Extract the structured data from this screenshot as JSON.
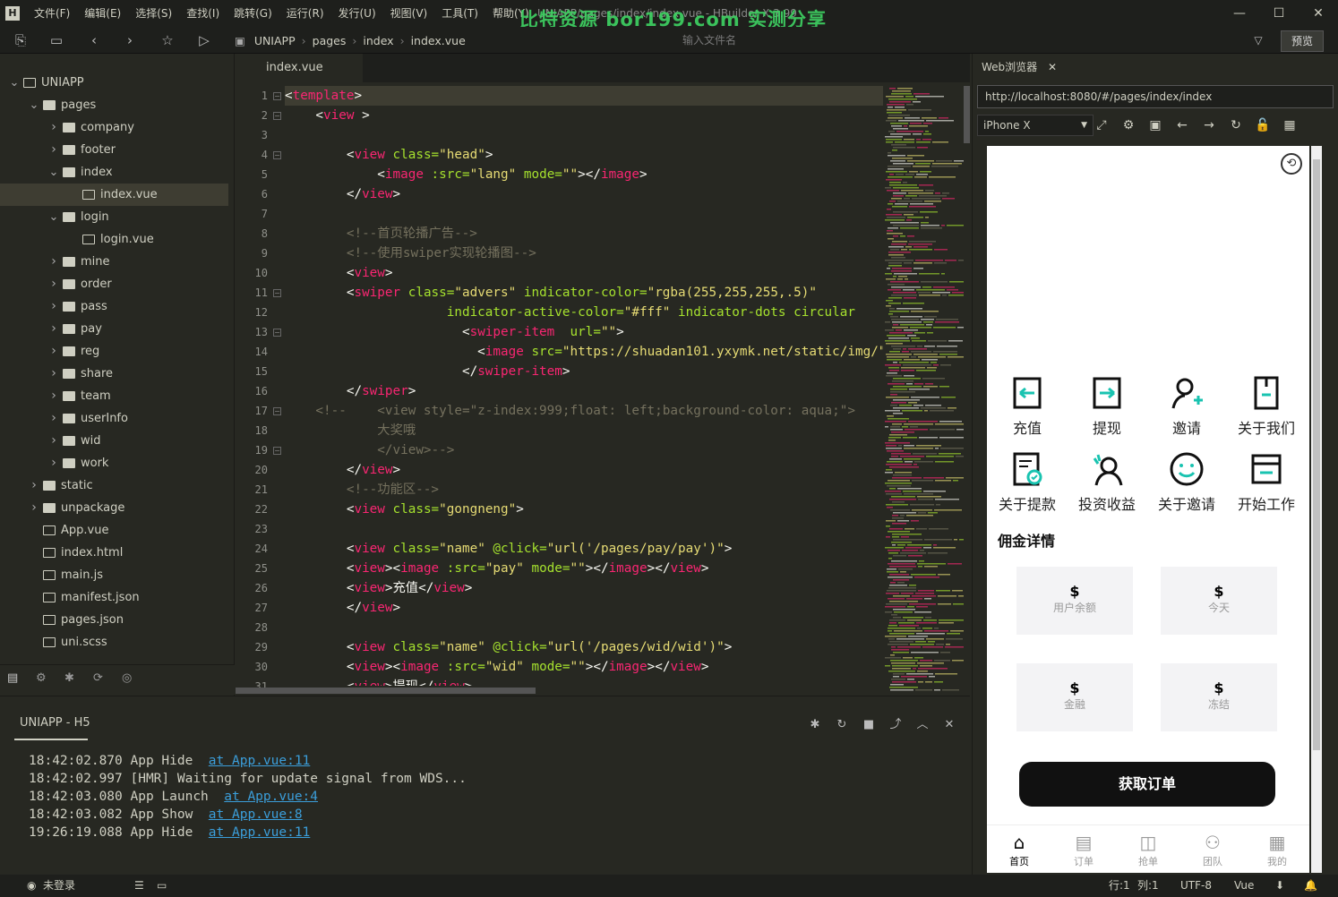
{
  "app": {
    "window_title": "UNIAPP/pages/index/index.vue - HBuilder X 3.99",
    "watermark": "比特资源 bor199.com 实测分享"
  },
  "menu": [
    "文件(F)",
    "编辑(E)",
    "选择(S)",
    "查找(I)",
    "跳转(G)",
    "运行(R)",
    "发行(U)",
    "视图(V)",
    "工具(T)",
    "帮助(Y)"
  ],
  "breadcrumb": [
    "UNIAPP",
    "pages",
    "index",
    "index.vue"
  ],
  "toolbar": {
    "file_search_placeholder": "输入文件名",
    "preview_label": "预览"
  },
  "sidebar": {
    "project": "UNIAPP",
    "items": [
      {
        "label": "pages",
        "type": "folder",
        "depth": 1,
        "open": true
      },
      {
        "label": "company",
        "type": "folder",
        "depth": 2,
        "open": false
      },
      {
        "label": "footer",
        "type": "folder",
        "depth": 2,
        "open": false
      },
      {
        "label": "index",
        "type": "folder",
        "depth": 2,
        "open": true
      },
      {
        "label": "index.vue",
        "type": "vue",
        "depth": 3,
        "selected": true
      },
      {
        "label": "login",
        "type": "folder",
        "depth": 2,
        "open": true
      },
      {
        "label": "login.vue",
        "type": "vue",
        "depth": 3
      },
      {
        "label": "mine",
        "type": "folder",
        "depth": 2,
        "open": false
      },
      {
        "label": "order",
        "type": "folder",
        "depth": 2,
        "open": false
      },
      {
        "label": "pass",
        "type": "folder",
        "depth": 2,
        "open": false
      },
      {
        "label": "pay",
        "type": "folder",
        "depth": 2,
        "open": false
      },
      {
        "label": "reg",
        "type": "folder",
        "depth": 2,
        "open": false
      },
      {
        "label": "share",
        "type": "folder",
        "depth": 2,
        "open": false
      },
      {
        "label": "team",
        "type": "folder",
        "depth": 2,
        "open": false
      },
      {
        "label": "userInfo",
        "type": "folder",
        "depth": 2,
        "open": false
      },
      {
        "label": "wid",
        "type": "folder",
        "depth": 2,
        "open": false
      },
      {
        "label": "work",
        "type": "folder",
        "depth": 2,
        "open": false
      },
      {
        "label": "static",
        "type": "folder",
        "depth": 1,
        "open": false
      },
      {
        "label": "unpackage",
        "type": "folder",
        "depth": 1,
        "open": false
      },
      {
        "label": "App.vue",
        "type": "vue",
        "depth": 1
      },
      {
        "label": "index.html",
        "type": "html",
        "depth": 1
      },
      {
        "label": "main.js",
        "type": "js",
        "depth": 1
      },
      {
        "label": "manifest.json",
        "type": "json",
        "depth": 1
      },
      {
        "label": "pages.json",
        "type": "json",
        "depth": 1
      },
      {
        "label": "uni.scss",
        "type": "scss",
        "depth": 1
      }
    ]
  },
  "editor": {
    "tab": "index.vue",
    "lines": [
      [
        [
          "tx",
          "<"
        ],
        [
          "tg",
          "template"
        ],
        [
          "tx",
          ">"
        ]
      ],
      [
        [
          "tx",
          "    <"
        ],
        [
          "tg",
          "view"
        ],
        [
          "tx",
          " >"
        ]
      ],
      [],
      [
        [
          "tx",
          "        <"
        ],
        [
          "tg",
          "view"
        ],
        [
          "at",
          " class="
        ],
        [
          "st",
          "\"head\""
        ],
        [
          "tx",
          ">"
        ]
      ],
      [
        [
          "tx",
          "            <"
        ],
        [
          "tg",
          "image"
        ],
        [
          "at",
          " :src="
        ],
        [
          "st",
          "\"lang\""
        ],
        [
          "at",
          " mode="
        ],
        [
          "st",
          "\"\""
        ],
        [
          "tx",
          "></"
        ],
        [
          "tg",
          "image"
        ],
        [
          "tx",
          ">"
        ]
      ],
      [
        [
          "tx",
          "        </"
        ],
        [
          "tg",
          "view"
        ],
        [
          "tx",
          ">"
        ]
      ],
      [],
      [
        [
          "cm",
          "        <!--首页轮播广告-->"
        ]
      ],
      [
        [
          "cm",
          "        <!--使用swiper实现轮播图-->"
        ]
      ],
      [
        [
          "tx",
          "        <"
        ],
        [
          "tg",
          "view"
        ],
        [
          "tx",
          ">"
        ]
      ],
      [
        [
          "tx",
          "        <"
        ],
        [
          "tg",
          "swiper"
        ],
        [
          "at",
          " class="
        ],
        [
          "st",
          "\"advers\""
        ],
        [
          "at",
          " indicator-color="
        ],
        [
          "st",
          "\"rgba(255,255,255,.5)\""
        ]
      ],
      [
        [
          "at",
          "                     indicator-active-color="
        ],
        [
          "st",
          "\"#fff\""
        ],
        [
          "at",
          " indicator-dots circular"
        ]
      ],
      [
        [
          "tx",
          "                       <"
        ],
        [
          "tg",
          "swiper-item"
        ],
        [
          "at",
          "  url="
        ],
        [
          "st",
          "\"\""
        ],
        [
          "tx",
          ">"
        ]
      ],
      [
        [
          "tx",
          "                         <"
        ],
        [
          "tg",
          "image"
        ],
        [
          "at",
          " src="
        ],
        [
          "st",
          "\"https://shuadan101.yxymk.net/static/img/\""
        ]
      ],
      [
        [
          "tx",
          "                       </"
        ],
        [
          "tg",
          "swiper-item"
        ],
        [
          "tx",
          ">"
        ]
      ],
      [
        [
          "tx",
          "        </"
        ],
        [
          "tg",
          "swiper"
        ],
        [
          "tx",
          ">"
        ]
      ],
      [
        [
          "cm",
          "    <!--    <view style=\"z-index:999;float: left;background-color: aqua;\">"
        ]
      ],
      [
        [
          "cm",
          "            大奖哦"
        ]
      ],
      [
        [
          "cm",
          "            </view>-->"
        ]
      ],
      [
        [
          "tx",
          "        </"
        ],
        [
          "tg",
          "view"
        ],
        [
          "tx",
          ">"
        ]
      ],
      [
        [
          "cm",
          "        <!--功能区-->"
        ]
      ],
      [
        [
          "tx",
          "        <"
        ],
        [
          "tg",
          "view"
        ],
        [
          "at",
          " class="
        ],
        [
          "st",
          "\"gongneng\""
        ],
        [
          "tx",
          ">"
        ]
      ],
      [],
      [
        [
          "tx",
          "        <"
        ],
        [
          "tg",
          "view"
        ],
        [
          "at",
          " class="
        ],
        [
          "st",
          "\"name\""
        ],
        [
          "at",
          " @click="
        ],
        [
          "st",
          "\"url('/pages/pay/pay')\""
        ],
        [
          "tx",
          ">"
        ]
      ],
      [
        [
          "tx",
          "        <"
        ],
        [
          "tg",
          "view"
        ],
        [
          "tx",
          "><"
        ],
        [
          "tg",
          "image"
        ],
        [
          "at",
          " :src="
        ],
        [
          "st",
          "\"pay\""
        ],
        [
          "at",
          " mode="
        ],
        [
          "st",
          "\"\""
        ],
        [
          "tx",
          "></"
        ],
        [
          "tg",
          "image"
        ],
        [
          "tx",
          "></"
        ],
        [
          "tg",
          "view"
        ],
        [
          "tx",
          ">"
        ]
      ],
      [
        [
          "tx",
          "        <"
        ],
        [
          "tg",
          "view"
        ],
        [
          "tx",
          ">充值</"
        ],
        [
          "tg",
          "view"
        ],
        [
          "tx",
          ">"
        ]
      ],
      [
        [
          "tx",
          "        </"
        ],
        [
          "tg",
          "view"
        ],
        [
          "tx",
          ">"
        ]
      ],
      [],
      [
        [
          "tx",
          "        <"
        ],
        [
          "tg",
          "view"
        ],
        [
          "at",
          " class="
        ],
        [
          "st",
          "\"name\""
        ],
        [
          "at",
          " @click="
        ],
        [
          "st",
          "\"url('/pages/wid/wid')\""
        ],
        [
          "tx",
          ">"
        ]
      ],
      [
        [
          "tx",
          "        <"
        ],
        [
          "tg",
          "view"
        ],
        [
          "tx",
          "><"
        ],
        [
          "tg",
          "image"
        ],
        [
          "at",
          " :src="
        ],
        [
          "st",
          "\"wid\""
        ],
        [
          "at",
          " mode="
        ],
        [
          "st",
          "\"\""
        ],
        [
          "tx",
          "></"
        ],
        [
          "tg",
          "image"
        ],
        [
          "tx",
          "></"
        ],
        [
          "tg",
          "view"
        ],
        [
          "tx",
          ">"
        ]
      ],
      [
        [
          "tx",
          "        <"
        ],
        [
          "tg",
          "view"
        ],
        [
          "tx",
          ">提现</"
        ],
        [
          "tg",
          "view"
        ],
        [
          "tx",
          ">"
        ]
      ]
    ]
  },
  "browser": {
    "tab": "Web浏览器",
    "url": "http://localhost:8080/#/pages/index/index",
    "device": "iPhone X",
    "grid": [
      "充值",
      "提现",
      "邀请",
      "关于我们",
      "关于提款",
      "投资收益",
      "关于邀请",
      "开始工作"
    ],
    "section_title": "佣金详情",
    "cards": [
      {
        "value": "$",
        "label": "用户余额"
      },
      {
        "value": "$",
        "label": "今天"
      },
      {
        "value": "$",
        "label": "金融"
      },
      {
        "value": "$",
        "label": "冻结"
      }
    ],
    "order_button": "获取订单",
    "tabbar": [
      "首页",
      "订单",
      "抢单",
      "团队",
      "我的"
    ]
  },
  "console": {
    "title": "UNIAPP - H5",
    "logs": [
      {
        "text": "18:42:02.870 App Hide  ",
        "link": "at App.vue:11"
      },
      {
        "text": "18:42:02.997 [HMR] Waiting for update signal from WDS...",
        "link": ""
      },
      {
        "text": "18:42:03.080 App Launch  ",
        "link": "at App.vue:4"
      },
      {
        "text": "18:42:03.082 App Show  ",
        "link": "at App.vue:8"
      },
      {
        "text": "19:26:19.088 App Hide  ",
        "link": "at App.vue:11"
      }
    ]
  },
  "status": {
    "login": "未登录",
    "row": "行:1",
    "col": "列:1",
    "encoding": "UTF-8",
    "language": "Vue"
  }
}
